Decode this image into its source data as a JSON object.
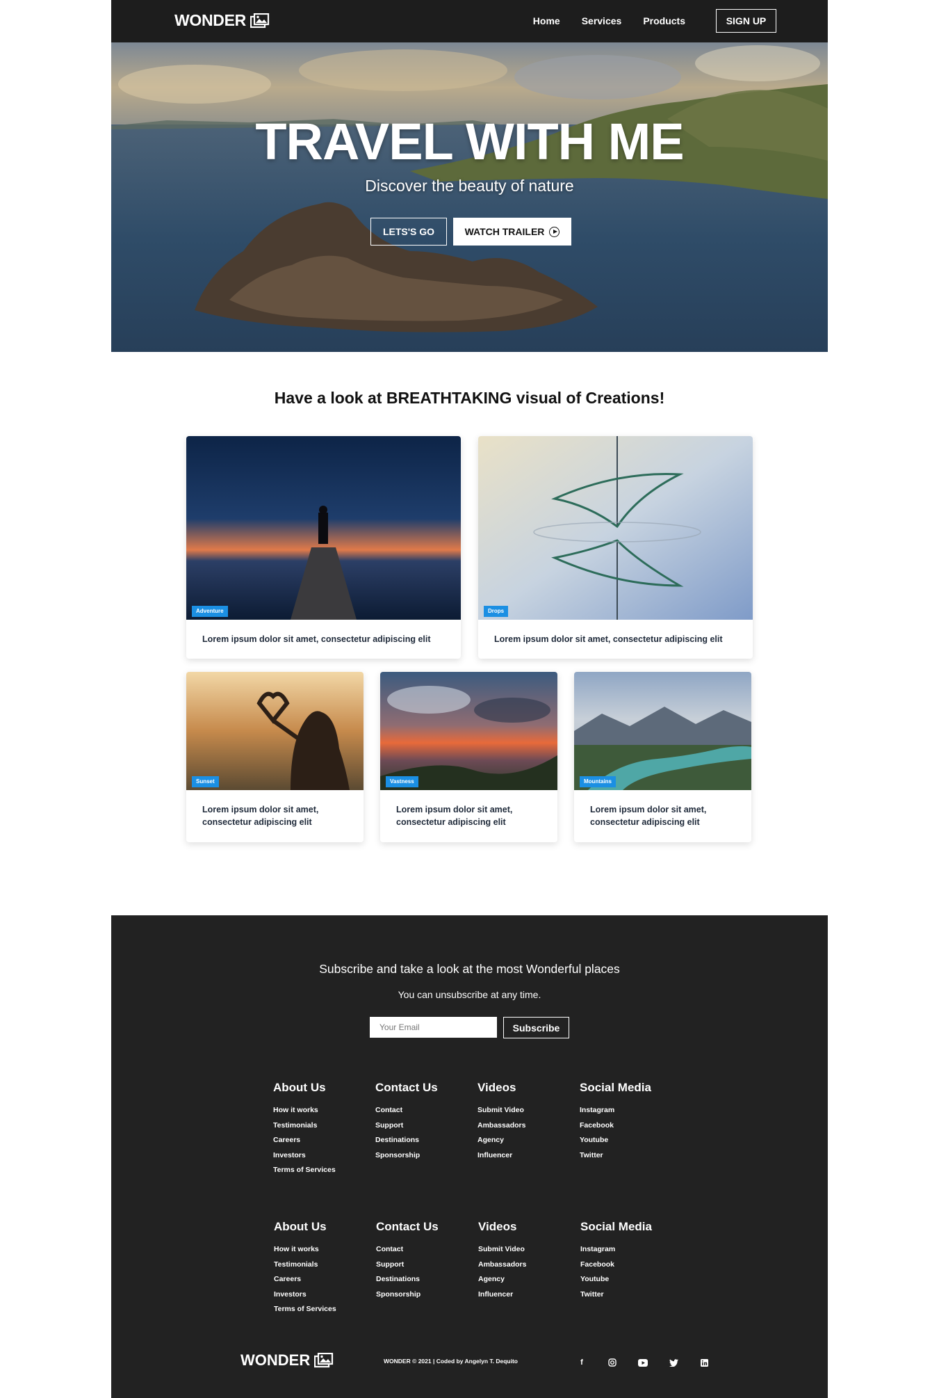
{
  "nav": {
    "brand": "WONDER",
    "links": [
      "Home",
      "Services",
      "Products"
    ],
    "signup": "SIGN UP"
  },
  "hero": {
    "title": "TRAVEL WITH ME",
    "subtitle": "Discover the beauty of nature",
    "primary_button": "LETS'S GO",
    "secondary_button": "WATCH TRAILER"
  },
  "gallery": {
    "title": "Have a look at BREATHTAKING visual of Creations!",
    "cards": [
      {
        "tag": "Adventure",
        "text": "Lorem ipsum dolor sit amet, consectetur adipiscing elit"
      },
      {
        "tag": "Drops",
        "text": "Lorem ipsum dolor sit amet, consectetur adipiscing elit"
      },
      {
        "tag": "Sunset",
        "text": "Lorem ipsum dolor sit amet, consectetur adipiscing elit"
      },
      {
        "tag": "Vastness",
        "text": "Lorem ipsum dolor sit amet, consectetur adipiscing elit"
      },
      {
        "tag": "Mountains",
        "text": "Lorem ipsum dolor sit amet, consectetur adipiscing elit"
      }
    ]
  },
  "subscribe": {
    "title": "Subscribe and take a look at the most Wonderful places",
    "note": "You can unsubscribe at any time.",
    "placeholder": "Your Email",
    "button": "Subscribe"
  },
  "footer_columns": [
    {
      "heading": "About Us",
      "links": [
        "How it works",
        "Testimonials",
        "Careers",
        "Investors",
        "Terms of Services"
      ]
    },
    {
      "heading": "Contact Us",
      "links": [
        "Contact",
        "Support",
        "Destinations",
        "Sponsorship"
      ]
    },
    {
      "heading": "Videos",
      "links": [
        "Submit Video",
        "Ambassadors",
        "Agency",
        "Influencer"
      ]
    },
    {
      "heading": "Social Media",
      "links": [
        "Instagram",
        "Facebook",
        "Youtube",
        "Twitter"
      ]
    }
  ],
  "footer_bottom": {
    "brand": "WONDER",
    "copyright": "WONDER © 2021 | Coded by Angelyn T. Dequito",
    "social_icons": [
      "facebook-icon",
      "instagram-icon",
      "youtube-icon",
      "twitter-icon",
      "linkedin-icon"
    ]
  },
  "colors": {
    "nav_bg": "#1d1d1d",
    "footer_bg": "#222222",
    "tag_blue": "#1b8fe3"
  }
}
